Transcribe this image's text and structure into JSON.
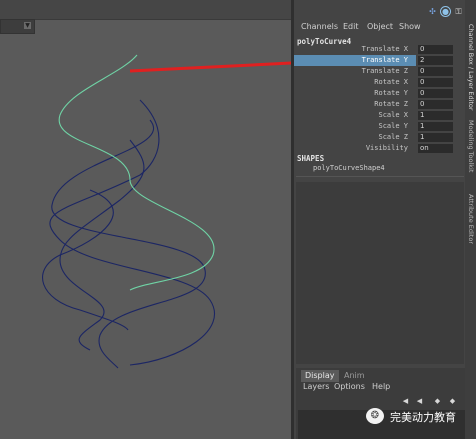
{
  "channel_box": {
    "menu": [
      "Channels",
      "Edit",
      "Object",
      "Show"
    ],
    "node_name": "polyToCurve4",
    "attributes": [
      {
        "label": "Translate X",
        "value": "0"
      },
      {
        "label": "Translate Y",
        "value": "2",
        "selected": true
      },
      {
        "label": "Translate Z",
        "value": "0"
      },
      {
        "label": "Rotate X",
        "value": "0"
      },
      {
        "label": "Rotate Y",
        "value": "0"
      },
      {
        "label": "Rotate Z",
        "value": "0"
      },
      {
        "label": "Scale X",
        "value": "1"
      },
      {
        "label": "Scale Y",
        "value": "1"
      },
      {
        "label": "Scale Z",
        "value": "1"
      },
      {
        "label": "Visibility",
        "value": "on"
      }
    ],
    "shapes_title": "SHAPES",
    "shape_name": "polyToCurveShape4"
  },
  "side_tabs": [
    "Channel Box / Layer Editor",
    "Modeling Toolkit",
    "Attribute Editor"
  ],
  "layer_editor": {
    "tabs": [
      "Display",
      "Anim"
    ],
    "menu": [
      "Layers",
      "Options",
      "Help"
    ],
    "icons": [
      "layer-up-icon",
      "layer-down-icon",
      "new-layer-icon",
      "new-layer-selected-icon"
    ]
  },
  "watermark": {
    "text": "完美动力教育"
  },
  "colors": {
    "viewport_bg": "#5a5a5a",
    "panel_bg": "#444444",
    "selected_row": "#5b8db3",
    "curve_selected": "#6fd3a5",
    "curve_dark": "#1c2664",
    "arrow": "#e02020"
  }
}
